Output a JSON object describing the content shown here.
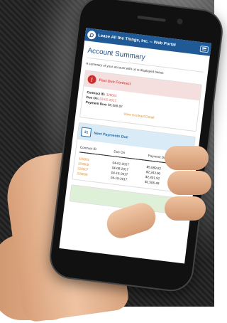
{
  "app": {
    "logo_letter": "D",
    "title": "Lease All the Things, Inc. -- Web Portal"
  },
  "page": {
    "title": "Account Summary",
    "intro": "A summary of your account with us is displayed below."
  },
  "past_due": {
    "heading": "Past Due Contract",
    "icon": "!",
    "contract_label": "Contract ID:",
    "contract_value": "329001",
    "due_label": "Due On:",
    "due_value": "03-01-2017",
    "payment_label": "Payment Due:",
    "payment_value": "$5,089.82",
    "link": "View Contract Detail"
  },
  "next_payments": {
    "heading": "Next Payments Due",
    "icon": "31",
    "columns": [
      "Contract ID",
      "Due On",
      "Payment Due"
    ],
    "rows": [
      {
        "id": "329001",
        "due": "04-01-2017",
        "amount": "$5,089.82"
      },
      {
        "id": "329008",
        "due": "04-08-2017",
        "amount": "$2,343.90"
      },
      {
        "id": "329007",
        "due": "04-15-2017",
        "amount": "$2,401.92"
      },
      {
        "id": "329008",
        "due": "04-19-2017",
        "amount": "$2,506.48"
      }
    ]
  },
  "colors": {
    "brand": "#1f5a96",
    "warning": "#d9534f",
    "accent": "#e08e2a"
  }
}
